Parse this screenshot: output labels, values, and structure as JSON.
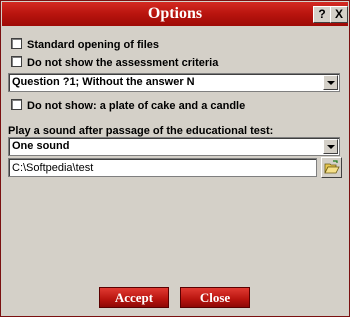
{
  "window": {
    "title": "Options",
    "help_label": "?",
    "close_label": "X"
  },
  "options": {
    "standard_opening": {
      "label": "Standard opening of files",
      "checked": false
    },
    "hide_assessment": {
      "label": "Do not show the assessment criteria",
      "checked": false
    },
    "question_combo_value": "Question ?1; Without the answer N",
    "hide_cake": {
      "label": "Do not show: a plate of cake and a candle",
      "checked": false
    }
  },
  "sound": {
    "label": "Play a sound after passage of the educational test:",
    "combo_value": "One sound",
    "path_value": "C:\\Softpedia\\test"
  },
  "buttons": {
    "accept": "Accept",
    "close": "Close"
  },
  "colors": {
    "titlebar": "#b8140e",
    "button": "#c41e18",
    "face": "#d4d0c8"
  }
}
